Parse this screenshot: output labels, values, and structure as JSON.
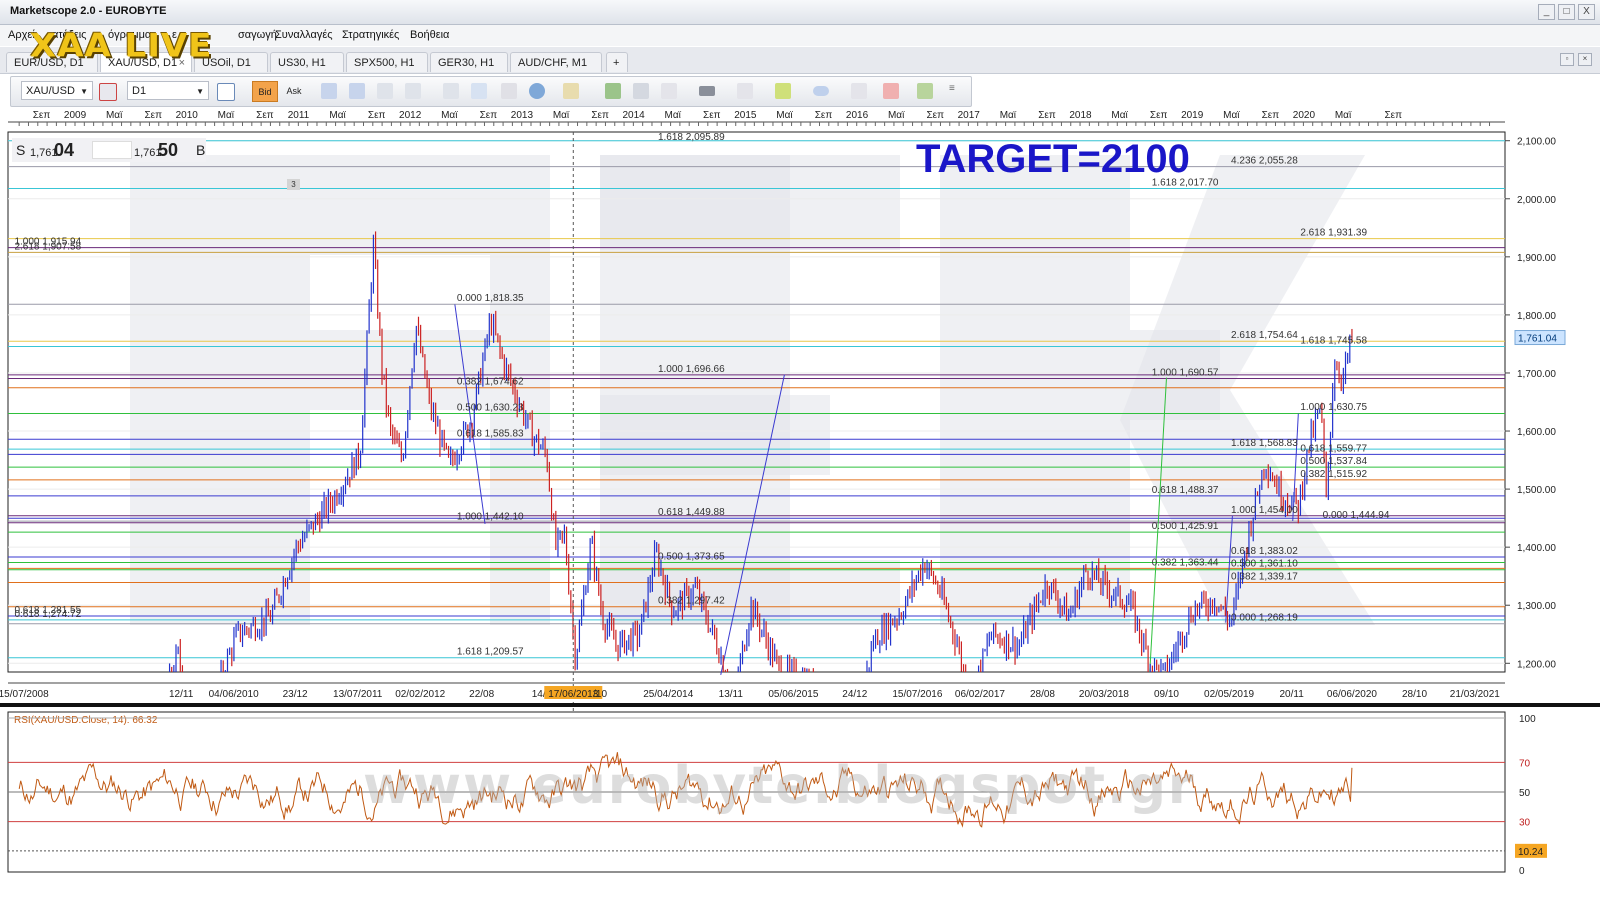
{
  "window": {
    "title": "Marketscope 2.0 - EUROBYTE",
    "buttons": [
      "_",
      "□",
      "X"
    ]
  },
  "menu": {
    "items": [
      "Αρχεί",
      "ατάξεις",
      "όγραμμα",
      "ε τ",
      "σαγωγή",
      "Συναλλαγές",
      "Στρατηγικές",
      "Βοήθεια"
    ]
  },
  "logo": {
    "text": "XAA LIVE"
  },
  "tabs": [
    {
      "label": "EUR/USD, D1"
    },
    {
      "label": "XAU/USD, D1",
      "active": true
    },
    {
      "label": "USOil, D1"
    },
    {
      "label": "US30, H1"
    },
    {
      "label": "SPX500, H1"
    },
    {
      "label": "GER30, H1"
    },
    {
      "label": "AUD/CHF, M1"
    }
  ],
  "toolbar": {
    "instrument": "XAU/USD",
    "timeframe": "D1",
    "bid_label": "Bid",
    "ask_label": "Ask"
  },
  "readout": {
    "sell_label": "S",
    "bid_prefix": "1,761",
    "bid_big": "04",
    "ask_prefix": "1,761",
    "ask_big": "50",
    "buy_label": "B",
    "tag": "3"
  },
  "annotation": {
    "target_text": "TARGET=2100",
    "watermark": "www.eurobyte.blogspot.gr"
  },
  "colors": {
    "up": "#2233cc",
    "down": "#cc2222",
    "rsi": "#c05a14",
    "target": "#1a16c8",
    "price_tag": "#cce4ff",
    "rsi_tag": "#f5a623"
  },
  "chart_data": {
    "type": "candlestick",
    "symbol": "XAU/USD",
    "timeframe": "D1",
    "last_price": "1,761.04",
    "y_ticks": [
      "2,100.00",
      "2,000.00",
      "1,900.00",
      "1,800.00",
      "1,700.00",
      "1,600.00",
      "1,500.00",
      "1,400.00",
      "1,300.00",
      "1,200.00"
    ],
    "ylim": [
      1185,
      2115
    ],
    "top_axis_labels": [
      {
        "t": 2008.7,
        "label": "Σεπ"
      },
      {
        "t": 2009.0,
        "label": "2009"
      },
      {
        "t": 2009.35,
        "label": "Μαϊ"
      },
      {
        "t": 2009.7,
        "label": "Σεπ"
      },
      {
        "t": 2010.0,
        "label": "2010"
      },
      {
        "t": 2010.35,
        "label": "Μαϊ"
      },
      {
        "t": 2010.7,
        "label": "Σεπ"
      },
      {
        "t": 2011.0,
        "label": "2011"
      },
      {
        "t": 2011.35,
        "label": "Μαϊ"
      },
      {
        "t": 2011.7,
        "label": "Σεπ"
      },
      {
        "t": 2012.0,
        "label": "2012"
      },
      {
        "t": 2012.35,
        "label": "Μαϊ"
      },
      {
        "t": 2012.7,
        "label": "Σεπ"
      },
      {
        "t": 2013.0,
        "label": "2013"
      },
      {
        "t": 2013.35,
        "label": "Μαϊ"
      },
      {
        "t": 2013.7,
        "label": "Σεπ"
      },
      {
        "t": 2014.0,
        "label": "2014"
      },
      {
        "t": 2014.35,
        "label": "Μαϊ"
      },
      {
        "t": 2014.7,
        "label": "Σεπ"
      },
      {
        "t": 2015.0,
        "label": "2015"
      },
      {
        "t": 2015.35,
        "label": "Μαϊ"
      },
      {
        "t": 2015.7,
        "label": "Σεπ"
      },
      {
        "t": 2016.0,
        "label": "2016"
      },
      {
        "t": 2016.35,
        "label": "Μαϊ"
      },
      {
        "t": 2016.7,
        "label": "Σεπ"
      },
      {
        "t": 2017.0,
        "label": "2017"
      },
      {
        "t": 2017.35,
        "label": "Μαϊ"
      },
      {
        "t": 2017.7,
        "label": "Σεπ"
      },
      {
        "t": 2018.0,
        "label": "2018"
      },
      {
        "t": 2018.35,
        "label": "Μαϊ"
      },
      {
        "t": 2018.7,
        "label": "Σεπ"
      },
      {
        "t": 2019.0,
        "label": "2019"
      },
      {
        "t": 2019.35,
        "label": "Μαϊ"
      },
      {
        "t": 2019.7,
        "label": "Σεπ"
      },
      {
        "t": 2020.0,
        "label": "2020"
      },
      {
        "t": 2020.35,
        "label": "Μαϊ"
      },
      {
        "t": 2020.8,
        "label": "Σεπ"
      }
    ],
    "bottom_axis_labels": [
      {
        "t": 2008.54,
        "label": "15/07/2008"
      },
      {
        "t": 2009.95,
        "label": "12/11"
      },
      {
        "t": 2010.42,
        "label": "04/06/2010"
      },
      {
        "t": 2010.97,
        "label": "23/12"
      },
      {
        "t": 2011.53,
        "label": "13/07/2011"
      },
      {
        "t": 2012.09,
        "label": "02/02/2012"
      },
      {
        "t": 2012.64,
        "label": "22/08"
      },
      {
        "t": 2013.2,
        "label": "14/03"
      },
      {
        "t": 2013.46,
        "label": "17/06/2013",
        "highlight": true
      },
      {
        "t": 2013.7,
        "label": "/10"
      },
      {
        "t": 2014.31,
        "label": "25/04/2014"
      },
      {
        "t": 2014.87,
        "label": "13/11"
      },
      {
        "t": 2015.43,
        "label": "05/06/2015"
      },
      {
        "t": 2015.98,
        "label": "24/12"
      },
      {
        "t": 2016.54,
        "label": "15/07/2016"
      },
      {
        "t": 2017.1,
        "label": "06/02/2017"
      },
      {
        "t": 2017.66,
        "label": "28/08"
      },
      {
        "t": 2018.21,
        "label": "20/03/2018"
      },
      {
        "t": 2018.77,
        "label": "09/10"
      },
      {
        "t": 2019.33,
        "label": "02/05/2019"
      },
      {
        "t": 2019.89,
        "label": "20/11"
      },
      {
        "t": 2020.43,
        "label": "06/06/2020"
      },
      {
        "t": 2020.99,
        "label": "28/10"
      },
      {
        "t": 2021.53,
        "label": "21/03/2021"
      }
    ],
    "x_range": [
      2008.4,
      2021.8
    ],
    "cursor_t": 2013.46,
    "price_anchors": [
      [
        2008.54,
        940
      ],
      [
        2008.85,
        760
      ],
      [
        2009.15,
        920
      ],
      [
        2009.55,
        1000
      ],
      [
        2009.92,
        1215
      ],
      [
        2010.1,
        1070
      ],
      [
        2010.45,
        1250
      ],
      [
        2010.75,
        1280
      ],
      [
        2010.98,
        1400
      ],
      [
        2011.3,
        1480
      ],
      [
        2011.55,
        1560
      ],
      [
        2011.67,
        1920
      ],
      [
        2011.75,
        1700
      ],
      [
        2011.82,
        1600
      ],
      [
        2011.93,
        1550
      ],
      [
        2012.05,
        1785
      ],
      [
        2012.18,
        1640
      ],
      [
        2012.35,
        1540
      ],
      [
        2012.55,
        1620
      ],
      [
        2012.72,
        1790
      ],
      [
        2012.83,
        1720
      ],
      [
        2012.95,
        1660
      ],
      [
        2013.1,
        1590
      ],
      [
        2013.22,
        1560
      ],
      [
        2013.3,
        1400
      ],
      [
        2013.38,
        1420
      ],
      [
        2013.48,
        1210
      ],
      [
        2013.62,
        1410
      ],
      [
        2013.72,
        1280
      ],
      [
        2013.85,
        1230
      ],
      [
        2014.05,
        1250
      ],
      [
        2014.2,
        1390
      ],
      [
        2014.35,
        1290
      ],
      [
        2014.55,
        1330
      ],
      [
        2014.75,
        1230
      ],
      [
        2014.9,
        1140
      ],
      [
        2015.05,
        1300
      ],
      [
        2015.3,
        1190
      ],
      [
        2015.55,
        1170
      ],
      [
        2015.85,
        1090
      ],
      [
        2015.95,
        1060
      ],
      [
        2016.15,
        1240
      ],
      [
        2016.4,
        1290
      ],
      [
        2016.6,
        1375
      ],
      [
        2016.75,
        1320
      ],
      [
        2016.92,
        1220
      ],
      [
        2017.0,
        1130
      ],
      [
        2017.2,
        1250
      ],
      [
        2017.45,
        1230
      ],
      [
        2017.7,
        1340
      ],
      [
        2017.9,
        1280
      ],
      [
        2018.05,
        1360
      ],
      [
        2018.3,
        1320
      ],
      [
        2018.45,
        1300
      ],
      [
        2018.62,
        1200
      ],
      [
        2018.75,
        1180
      ],
      [
        2019.0,
        1290
      ],
      [
        2019.2,
        1310
      ],
      [
        2019.35,
        1270
      ],
      [
        2019.5,
        1420
      ],
      [
        2019.65,
        1550
      ],
      [
        2019.8,
        1490
      ],
      [
        2019.95,
        1470
      ],
      [
        2020.05,
        1580
      ],
      [
        2020.15,
        1640
      ],
      [
        2020.2,
        1480
      ],
      [
        2020.27,
        1720
      ],
      [
        2020.35,
        1690
      ],
      [
        2020.43,
        1761
      ]
    ],
    "hlines": [
      {
        "y": 2100,
        "color": "#39c6d6"
      },
      {
        "y": 2055.28,
        "color": "#9a9aa8"
      },
      {
        "y": 2017.7,
        "color": "#39c6d6"
      },
      {
        "y": 1931.39,
        "color": "#e8c84a"
      },
      {
        "y": 1915.94,
        "color": "#6a2a7a"
      },
      {
        "y": 1907.58,
        "color": "#c8a040"
      },
      {
        "y": 1818.35,
        "color": "#9a9aa8"
      },
      {
        "y": 1754.64,
        "color": "#e8c84a"
      },
      {
        "y": 1745.58,
        "color": "#39c6d6"
      },
      {
        "y": 1696.66,
        "color": "#6a2a7a"
      },
      {
        "y": 1690.57,
        "color": "#6a2a7a"
      },
      {
        "y": 1674.62,
        "color": "#e0701c"
      },
      {
        "y": 1630.23,
        "color": "#2fc03c"
      },
      {
        "y": 1585.83,
        "color": "#3a3ad0"
      },
      {
        "y": 1568.83,
        "color": "#39c6d6"
      },
      {
        "y": 1559.77,
        "color": "#3a3ad0"
      },
      {
        "y": 1537.84,
        "color": "#2fc03c"
      },
      {
        "y": 1515.92,
        "color": "#e0701c"
      },
      {
        "y": 1488.37,
        "color": "#3a3ad0"
      },
      {
        "y": 1454.0,
        "color": "#6a2a7a"
      },
      {
        "y": 1449.88,
        "color": "#3a3ad0"
      },
      {
        "y": 1444.94,
        "color": "#9a9aa8"
      },
      {
        "y": 1442.1,
        "color": "#6a2a7a"
      },
      {
        "y": 1425.91,
        "color": "#2fc03c"
      },
      {
        "y": 1383.02,
        "color": "#3a3ad0"
      },
      {
        "y": 1373.65,
        "color": "#2fc03c"
      },
      {
        "y": 1363.44,
        "color": "#e0701c"
      },
      {
        "y": 1361.1,
        "color": "#2fc03c"
      },
      {
        "y": 1339.17,
        "color": "#e0701c"
      },
      {
        "y": 1297.42,
        "color": "#e0701c"
      },
      {
        "y": 1281.55,
        "color": "#3a3ad0"
      },
      {
        "y": 1274.72,
        "color": "#39c6d6"
      },
      {
        "y": 1268.19,
        "color": "#9a9aa8"
      },
      {
        "y": 1209.57,
        "color": "#39c6d6"
      }
    ],
    "fib_labels": [
      {
        "text": "1.618 2,095.89",
        "t": 2014.2,
        "y": 2095.89
      },
      {
        "text": "4.236 2,055.28",
        "t": 2019.33,
        "y": 2055.28
      },
      {
        "text": "1.618 2,017.70",
        "t": 2018.62,
        "y": 2017.7
      },
      {
        "text": "2.618 1,931.39",
        "t": 2019.95,
        "y": 1931.39
      },
      {
        "text": "1.000 1,915.94",
        "t": 2008.44,
        "y": 1915.94
      },
      {
        "text": "2.618 1,907.58",
        "t": 2008.44,
        "y": 1907.58
      },
      {
        "text": "0.000 1,818.35",
        "t": 2012.4,
        "y": 1818.35
      },
      {
        "text": "2.618 1,754.64",
        "t": 2019.33,
        "y": 1754.64
      },
      {
        "text": "1.618 1,745.58",
        "t": 2019.95,
        "y": 1745.58
      },
      {
        "text": "1.000 1,696.66",
        "t": 2014.2,
        "y": 1696.66
      },
      {
        "text": "1.000 1,690.57",
        "t": 2018.62,
        "y": 1690.57
      },
      {
        "text": "0.382 1,674.62",
        "t": 2012.4,
        "y": 1674.62
      },
      {
        "text": "1.000 1,630.75",
        "t": 2019.95,
        "y": 1630.75
      },
      {
        "text": "0.500 1,630.23",
        "t": 2012.4,
        "y": 1630.23
      },
      {
        "text": "0.618 1,585.83",
        "t": 2012.4,
        "y": 1585.83
      },
      {
        "text": "1.618 1,568.83",
        "t": 2019.33,
        "y": 1568.83
      },
      {
        "text": "0.618 1,559.77",
        "t": 2019.95,
        "y": 1559.77
      },
      {
        "text": "0.500 1,537.84",
        "t": 2019.95,
        "y": 1537.84
      },
      {
        "text": "0.382 1,515.92",
        "t": 2019.95,
        "y": 1515.92
      },
      {
        "text": "0.618 1,488.37",
        "t": 2018.62,
        "y": 1488.37
      },
      {
        "text": "1.000 1,454.00",
        "t": 2019.33,
        "y": 1454.0
      },
      {
        "text": "0.618 1,449.88",
        "t": 2014.2,
        "y": 1449.88
      },
      {
        "text": "0.000 1,444.94",
        "t": 2020.15,
        "y": 1444.94
      },
      {
        "text": "1.000 1,442.10",
        "t": 2012.4,
        "y": 1442.1
      },
      {
        "text": "0.500 1,425.91",
        "t": 2018.62,
        "y": 1425.91
      },
      {
        "text": "0.618 1,383.02",
        "t": 2019.33,
        "y": 1383.02
      },
      {
        "text": "0.500 1,373.65",
        "t": 2014.2,
        "y": 1373.65
      },
      {
        "text": "0.382 1,363.44",
        "t": 2018.62,
        "y": 1363.44
      },
      {
        "text": "0.500 1,361.10",
        "t": 2019.33,
        "y": 1361.1
      },
      {
        "text": "0.382 1,339.17",
        "t": 2019.33,
        "y": 1339.17
      },
      {
        "text": "0.382 1,297.42",
        "t": 2014.2,
        "y": 1297.42
      },
      {
        "text": "0.618 1,281.55",
        "t": 2008.44,
        "y": 1281.55
      },
      {
        "text": "0.618 1,274.72",
        "t": 2008.44,
        "y": 1274.72
      },
      {
        "text": "0.000 1,268.19",
        "t": 2019.33,
        "y": 1268.19
      },
      {
        "text": "1.618 1,209.57",
        "t": 2012.4,
        "y": 1209.57
      }
    ],
    "trend_lines": [
      {
        "t1": 2012.4,
        "y1": 1818,
        "t2": 2012.67,
        "y2": 1440,
        "color": "#3a3ad0"
      },
      {
        "t1": 2014.78,
        "y1": 1180,
        "t2": 2015.35,
        "y2": 1697,
        "color": "#3a3ad0"
      },
      {
        "t1": 2018.62,
        "y1": 1185,
        "t2": 2018.77,
        "y2": 1692,
        "color": "#2fc03c"
      },
      {
        "t1": 2019.3,
        "y1": 1270,
        "t2": 2019.36,
        "y2": 1454,
        "color": "#3a3ad0"
      },
      {
        "t1": 2019.9,
        "y1": 1445,
        "t2": 2019.95,
        "y2": 1630,
        "color": "#3a3ad0"
      }
    ],
    "rsi": {
      "label": "RSI(XAU/USD.Close, 14): 66.32",
      "levels": [
        "100",
        "70",
        "50",
        "30"
      ],
      "ylim": [
        0,
        100
      ],
      "tag_value": "10.24",
      "zero_label": "0",
      "last": 66.32
    }
  }
}
